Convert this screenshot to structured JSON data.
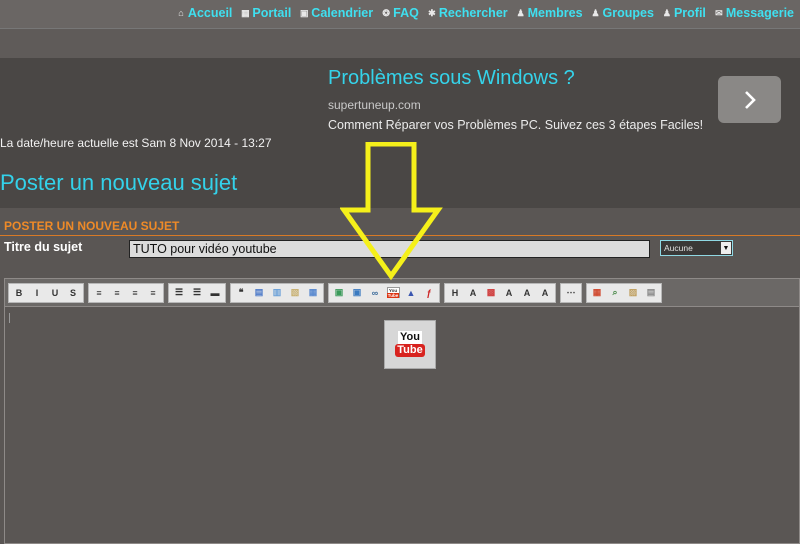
{
  "nav": {
    "items": [
      {
        "label": "Accueil",
        "icon": "home-icon",
        "glyph": "⌂"
      },
      {
        "label": "Portail",
        "icon": "portal-icon",
        "glyph": "▦"
      },
      {
        "label": "Calendrier",
        "icon": "calendar-icon",
        "glyph": "▣"
      },
      {
        "label": "FAQ",
        "icon": "faq-icon",
        "glyph": "❂"
      },
      {
        "label": "Rechercher",
        "icon": "search-icon",
        "glyph": "✱"
      },
      {
        "label": "Membres",
        "icon": "members-icon",
        "glyph": "♟"
      },
      {
        "label": "Groupes",
        "icon": "groups-icon",
        "glyph": "♟"
      },
      {
        "label": "Profil",
        "icon": "profile-icon",
        "glyph": "♟"
      },
      {
        "label": "Messagerie",
        "icon": "mail-icon",
        "glyph": "✉"
      }
    ]
  },
  "ad": {
    "title": "Problèmes sous Windows ?",
    "url": "supertuneup.com",
    "description": "Comment Réparer vos Problèmes PC. Suivez ces 3 étapes Faciles!",
    "arrow_glyph": "›"
  },
  "datetime": "La date/heure actuelle est Sam 8 Nov 2014 - 13:27",
  "page_title": "Poster un nouveau sujet",
  "form": {
    "section_title": "POSTER UN NOUVEAU SUJET",
    "subject_label": "Titre du sujet",
    "subject_value": "TUTO pour vidéo youtube",
    "select_value": "Aucune",
    "select_arrow": "▼"
  },
  "toolbar": {
    "groups": [
      [
        {
          "name": "bold-icon",
          "glyph": "B"
        },
        {
          "name": "italic-icon",
          "glyph": "I"
        },
        {
          "name": "underline-icon",
          "glyph": "U"
        },
        {
          "name": "strikethrough-icon",
          "glyph": "S"
        }
      ],
      [
        {
          "name": "align-left-icon",
          "glyph": "≡"
        },
        {
          "name": "align-center-icon",
          "glyph": "≡"
        },
        {
          "name": "align-right-icon",
          "glyph": "≡"
        },
        {
          "name": "align-justify-icon",
          "glyph": "≡"
        }
      ],
      [
        {
          "name": "bullet-list-icon",
          "glyph": "☰"
        },
        {
          "name": "numbered-list-icon",
          "glyph": "☰"
        },
        {
          "name": "horizontal-rule-icon",
          "glyph": "▬"
        }
      ],
      [
        {
          "name": "quote-icon",
          "glyph": "❝"
        },
        {
          "name": "code-icon",
          "glyph": "▤"
        },
        {
          "name": "spoiler-icon",
          "glyph": "▥"
        },
        {
          "name": "hide-icon",
          "glyph": "▧"
        },
        {
          "name": "table-icon",
          "glyph": "▦"
        }
      ],
      [
        {
          "name": "image-icon",
          "glyph": "▣"
        },
        {
          "name": "host-image-icon",
          "glyph": "▣"
        },
        {
          "name": "link-icon",
          "glyph": "∞"
        },
        {
          "name": "youtube-icon",
          "glyph": "yt"
        },
        {
          "name": "dailymotion-icon",
          "glyph": "▲"
        },
        {
          "name": "flash-icon",
          "glyph": "ƒ"
        }
      ],
      [
        {
          "name": "heading-icon",
          "glyph": "H"
        },
        {
          "name": "font-icon",
          "glyph": "A"
        },
        {
          "name": "color-icon",
          "glyph": "▩"
        },
        {
          "name": "font-size-icon",
          "glyph": "A"
        },
        {
          "name": "font-style-icon",
          "glyph": "A"
        },
        {
          "name": "remove-format-icon",
          "glyph": "A"
        }
      ],
      [
        {
          "name": "more-icon",
          "glyph": "⋯"
        }
      ],
      [
        {
          "name": "date-icon",
          "glyph": "▦"
        },
        {
          "name": "search-text-icon",
          "glyph": "⌕"
        },
        {
          "name": "clipboard-icon",
          "glyph": "▨"
        },
        {
          "name": "source-icon",
          "glyph": "▤"
        }
      ]
    ]
  },
  "editor": {
    "youtube_you": "You",
    "youtube_tube": "Tube",
    "mini_you": "You",
    "mini_tube": "Tube"
  },
  "colors": {
    "nav_link": "#3fe0f0",
    "section_accent": "#ee8a28",
    "arrow_yellow": "#f5f01a"
  }
}
